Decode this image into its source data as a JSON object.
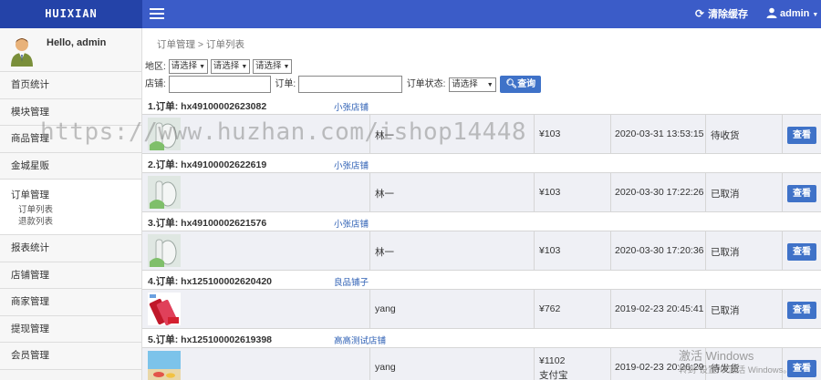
{
  "brand": "HUIXIAN",
  "topbar": {
    "clear_cache": "清除缓存",
    "user": "admin"
  },
  "profile": {
    "greeting": "Hello, admin"
  },
  "sidebar": {
    "items_top": [
      "首页统计",
      "模块管理",
      "商品管理",
      "金城星贩"
    ],
    "active_group": {
      "title": "订单管理",
      "subs": [
        "订单列表",
        "退款列表"
      ]
    },
    "items_bottom": [
      "报表统计",
      "店铺管理",
      "商家管理",
      "提现管理",
      "会员管理"
    ]
  },
  "breadcrumb": "订单管理 > 订单列表",
  "filters": {
    "region_label": "地区:",
    "region_selects": [
      "请选择",
      "请选择",
      "请选择"
    ],
    "shop_label": "店铺:",
    "order_label": "订单:",
    "status_label": "订单状态:",
    "status_select": "请选择",
    "search_btn": "查询"
  },
  "orders": [
    {
      "no": "1.订单: hx49100002623082",
      "shop": "小张店铺",
      "buyer": "林一",
      "price": "¥103",
      "price2": "",
      "time": "2020-03-31 13:53:15",
      "status": "待收货",
      "action": "查看",
      "thumb": "glass"
    },
    {
      "no": "2.订单: hx49100002622619",
      "shop": "小张店铺",
      "buyer": "林一",
      "price": "¥103",
      "price2": "",
      "time": "2020-03-30 17:22:26",
      "status": "已取消",
      "action": "查看",
      "thumb": "glass"
    },
    {
      "no": "3.订单: hx49100002621576",
      "shop": "小张店铺",
      "buyer": "林一",
      "price": "¥103",
      "price2": "",
      "time": "2020-03-30 17:20:36",
      "status": "已取消",
      "action": "查看",
      "thumb": "glass"
    },
    {
      "no": "4.订单: hx125100002620420",
      "shop": "良品铺子",
      "buyer": "yang",
      "price": "¥762",
      "price2": "",
      "time": "2019-02-23 20:45:41",
      "status": "已取消",
      "action": "查看",
      "thumb": "phone"
    },
    {
      "no": "5.订单: hx125100002619398",
      "shop": "高高测试店铺",
      "buyer": "yang",
      "price": "¥1102",
      "price2": "支付宝",
      "time": "2019-02-23 20:26:29",
      "status": "待发货",
      "action": "查看",
      "thumb": "beach"
    }
  ],
  "watermark": "https://www.huzhan.com/ishop14448",
  "windows_notice": {
    "title": "激活 Windows",
    "sub": "转到\"设置\"以激活 Windows。"
  }
}
